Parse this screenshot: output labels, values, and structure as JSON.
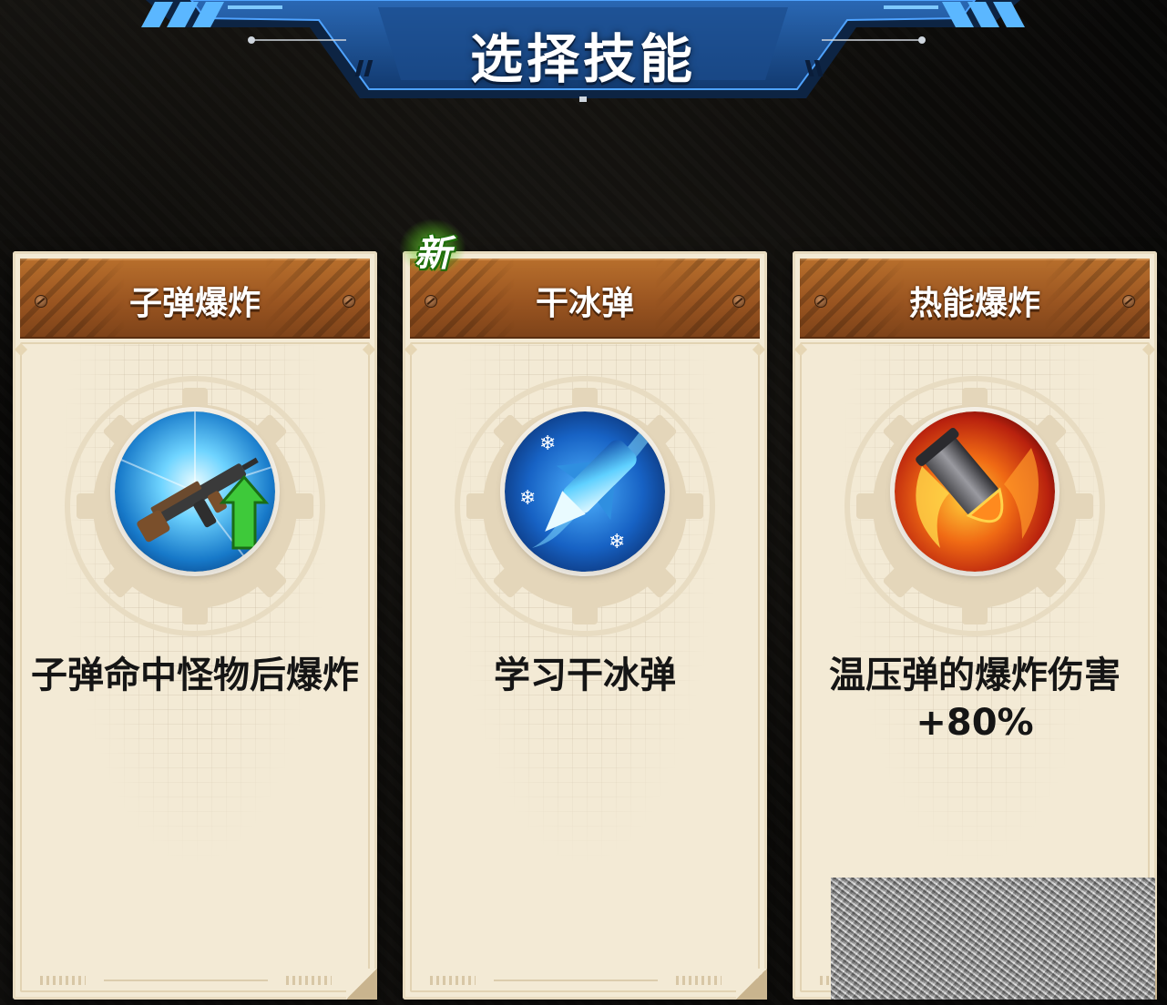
{
  "header": {
    "title": "选择技能"
  },
  "cards": [
    {
      "title": "子弹爆炸",
      "description": "子弹命中怪物后爆炸",
      "icon": "rifle-upgrade-icon",
      "is_new": false
    },
    {
      "title": "干冰弹",
      "description": "学习干冰弹",
      "icon": "ice-bullet-icon",
      "is_new": true
    },
    {
      "title": "热能爆炸",
      "description": "温压弹的爆炸伤害+80%",
      "icon": "fire-bullet-icon",
      "is_new": false
    }
  ],
  "badge": {
    "new_label": "新"
  },
  "colors": {
    "card_bg": "#f3ead5",
    "card_header": "#9a5521",
    "banner_blue": "#1d4f8f",
    "new_glow": "#78e63c"
  }
}
